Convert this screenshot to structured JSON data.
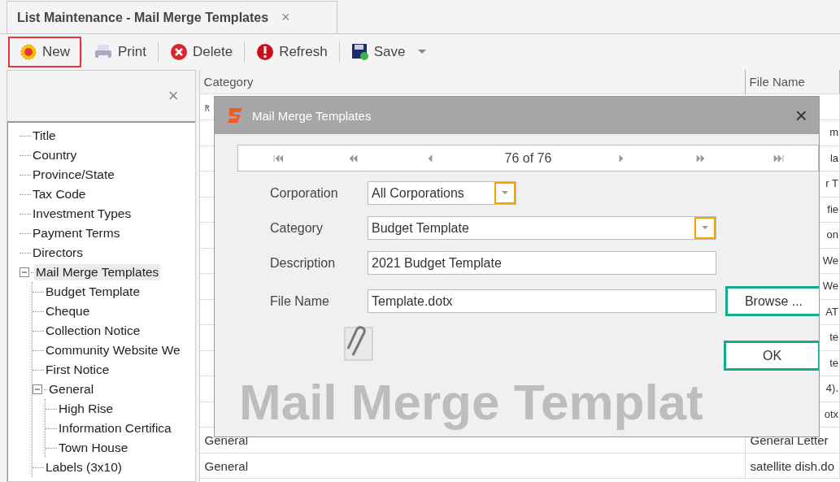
{
  "tab": {
    "title": "List Maintenance - Mail Merge Templates",
    "close": "×"
  },
  "toolbar": [
    {
      "label": "New",
      "kind": "new",
      "highlighted": true
    },
    {
      "label": "Print",
      "kind": "print",
      "highlighted": false
    },
    {
      "label": "Delete",
      "kind": "delete",
      "highlighted": false
    },
    {
      "label": "Refresh",
      "kind": "refresh",
      "highlighted": false
    },
    {
      "label": "Save",
      "kind": "save",
      "highlighted": false,
      "dropdown": true
    }
  ],
  "sidebar": {
    "close": "×",
    "tree": [
      {
        "label": "Title",
        "selected": false
      },
      {
        "label": "Country",
        "selected": false
      },
      {
        "label": "Province/State",
        "selected": false
      },
      {
        "label": "Tax Code",
        "selected": false
      },
      {
        "label": "Investment Types",
        "selected": false
      },
      {
        "label": "Payment Terms",
        "selected": false
      },
      {
        "label": "Directors",
        "selected": false
      },
      {
        "label": "Mail Merge Templates",
        "selected": true,
        "expanded": true,
        "children": [
          {
            "label": "Budget Template",
            "selected": false
          },
          {
            "label": "Cheque",
            "selected": false
          },
          {
            "label": "Collection Notice",
            "selected": false
          },
          {
            "label": "Community Website We",
            "selected": false
          },
          {
            "label": "First Notice",
            "selected": false
          },
          {
            "label": "General",
            "selected": false,
            "expanded": true,
            "children": [
              {
                "label": "High Rise",
                "selected": false
              },
              {
                "label": "Information Certifica",
                "selected": false
              },
              {
                "label": "Town House",
                "selected": false
              }
            ]
          },
          {
            "label": "Labels (3x10)",
            "selected": false
          }
        ]
      }
    ]
  },
  "table": {
    "columns": [
      "Category",
      "File Name"
    ],
    "rows": [
      {
        "file_name": "m",
        "covered": true
      },
      {
        "file_name": "la",
        "covered": true
      },
      {
        "file_name": "r T",
        "covered": true
      },
      {
        "file_name": "fie",
        "covered": true
      },
      {
        "file_name": "on",
        "covered": true
      },
      {
        "file_name": "We",
        "covered": true
      },
      {
        "file_name": "We",
        "covered": true
      },
      {
        "file_name": "AT",
        "covered": true
      },
      {
        "file_name": "te",
        "covered": true
      },
      {
        "file_name": "te",
        "covered": true
      },
      {
        "file_name": "4).",
        "covered": true
      },
      {
        "file_name": "otx",
        "covered": true
      },
      {
        "category": "General",
        "file_name": "General Letter",
        "covered": false
      },
      {
        "category": "General",
        "file_name": "satellite dish.do",
        "covered": false
      }
    ]
  },
  "dialog": {
    "title": "Mail Merge Templates",
    "close": "×",
    "navigator": {
      "position": "76 of 76"
    },
    "fields": [
      {
        "label": "Corporation",
        "value": "All Corporations",
        "kind": "dropdown",
        "highlighted": true
      },
      {
        "label": "Category",
        "value": "Budget Template",
        "kind": "dropdown",
        "highlighted": true
      },
      {
        "label": "Description",
        "value": "2021 Budget Template",
        "kind": "text"
      },
      {
        "label": "File Name",
        "value": "Template.dotx",
        "kind": "file"
      }
    ],
    "browse_button": {
      "label": "Browse ...",
      "highlighted": true
    },
    "ok_button": {
      "label": "OK",
      "highlighted": true
    },
    "background_caption": "Mail Merge Templat"
  }
}
